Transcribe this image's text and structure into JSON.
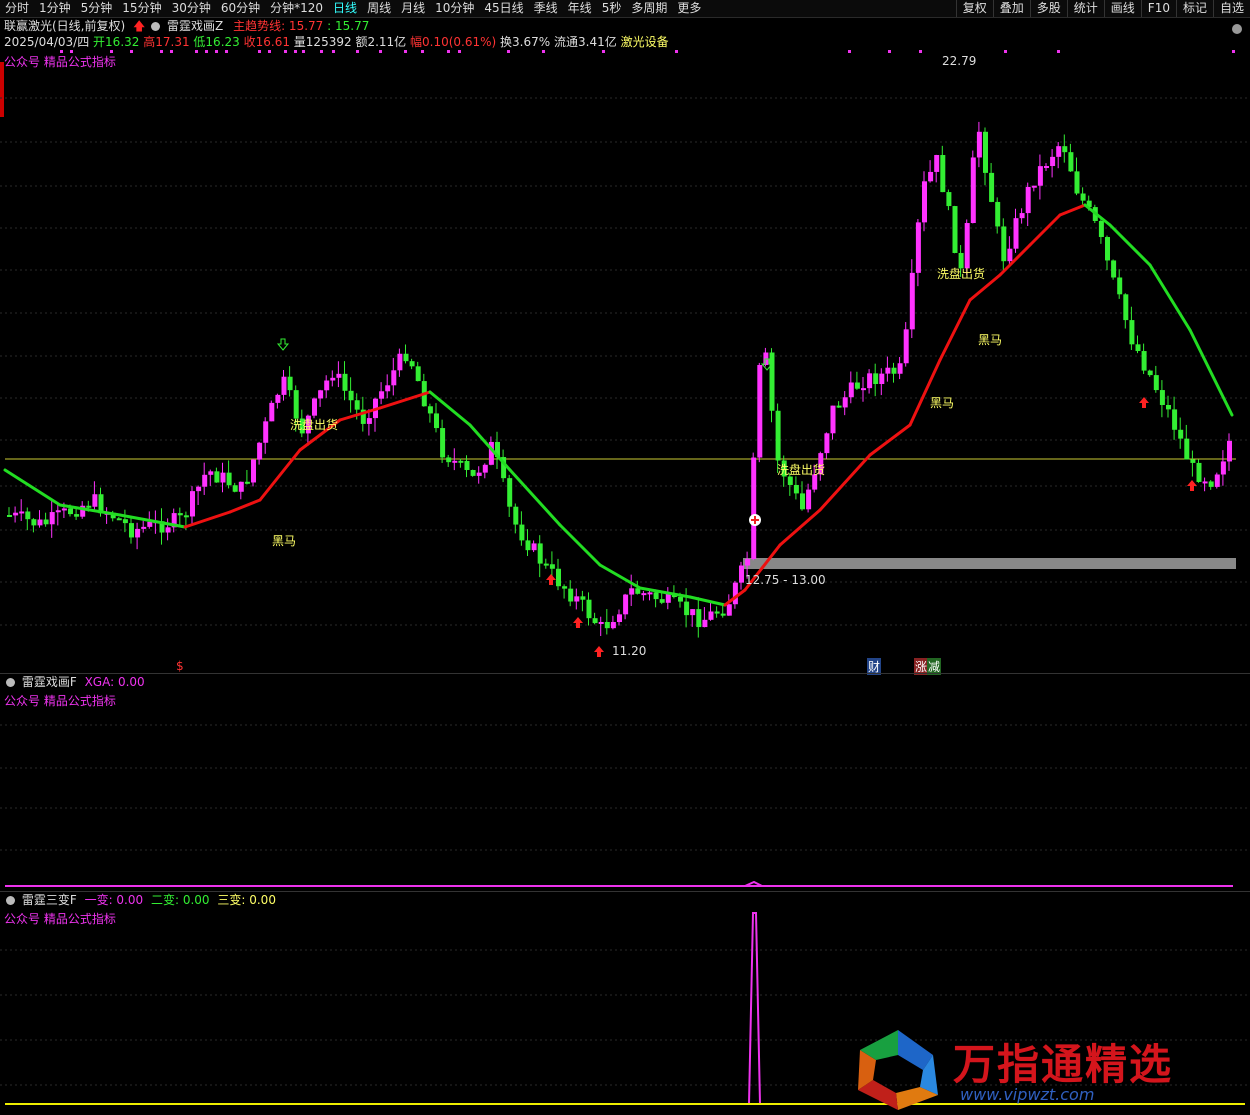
{
  "toolbar": {
    "periods": [
      "分时",
      "1分钟",
      "5分钟",
      "15分钟",
      "30分钟",
      "60分钟",
      "分钟*120",
      "日线",
      "周线",
      "月线",
      "10分钟",
      "45日线",
      "季线",
      "年线",
      "5秒",
      "多周期",
      "更多"
    ],
    "active_period": "日线",
    "tools": [
      "复权",
      "叠加",
      "多股",
      "统计",
      "画线",
      "F10",
      "标记",
      "自选"
    ]
  },
  "header": {
    "stock": "联赢激光(日线,前复权)",
    "indicator": "雷霆戏画Z",
    "trend_label": "主趋势线: 15.77",
    "trend_value2": ": 15.77",
    "date": "2025/04/03/四",
    "open": "开16.32",
    "high": "高17.31",
    "low": "低16.23",
    "close": "收16.61",
    "volume": "量125392",
    "amount": "额2.11亿",
    "change": "幅0.10(0.61%)",
    "turnover": "换3.67%",
    "float": "流通3.41亿",
    "sector": "激光设备"
  },
  "main_panel": {
    "watermark_label": "公众号 精品公式指标",
    "labels": {
      "high_price": "22.79",
      "low_price": "11.20",
      "range": "12.75 - 13.00",
      "washout": "洗盘出货",
      "dark_horse": "黑马",
      "s_marker": "$",
      "cai": "财",
      "zhang": "涨",
      "jian": "减"
    }
  },
  "panel2": {
    "name": "雷霆戏画F",
    "value": "XGA: 0.00",
    "watermark_label": "公众号 精品公式指标"
  },
  "panel3": {
    "name": "雷霆三变F",
    "v1": "一变: 0.00",
    "v2": "二变: 0.00",
    "v3": "三变: 0.00",
    "watermark_label": "公众号 精品公式指标"
  },
  "watermark": {
    "brand": "万指通精选",
    "url": "www.vipwzt.com"
  },
  "colors": {
    "up": "#ff33ff",
    "down": "#33ee33",
    "trend_up": "#ee1111",
    "trend_down": "#22dd22",
    "label_yellow": "#ffff66"
  }
}
